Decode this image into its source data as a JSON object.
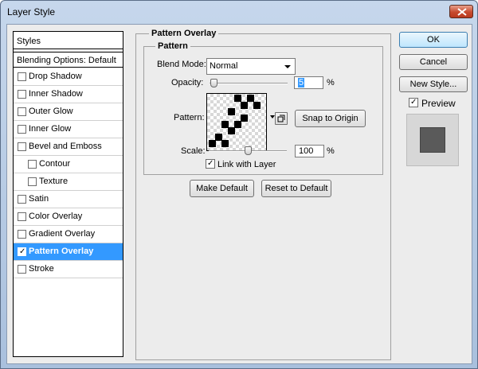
{
  "window": {
    "title": "Layer Style"
  },
  "styles_panel": {
    "header": "Styles",
    "blending_options": "Blending Options: Default",
    "items": [
      {
        "label": "Drop Shadow",
        "checked": false,
        "selected": false,
        "indent": false
      },
      {
        "label": "Inner Shadow",
        "checked": false,
        "selected": false,
        "indent": false
      },
      {
        "label": "Outer Glow",
        "checked": false,
        "selected": false,
        "indent": false
      },
      {
        "label": "Inner Glow",
        "checked": false,
        "selected": false,
        "indent": false
      },
      {
        "label": "Bevel and Emboss",
        "checked": false,
        "selected": false,
        "indent": false
      },
      {
        "label": "Contour",
        "checked": false,
        "selected": false,
        "indent": true
      },
      {
        "label": "Texture",
        "checked": false,
        "selected": false,
        "indent": true
      },
      {
        "label": "Satin",
        "checked": false,
        "selected": false,
        "indent": false
      },
      {
        "label": "Color Overlay",
        "checked": false,
        "selected": false,
        "indent": false
      },
      {
        "label": "Gradient Overlay",
        "checked": false,
        "selected": false,
        "indent": false
      },
      {
        "label": "Pattern Overlay",
        "checked": true,
        "selected": true,
        "indent": false
      },
      {
        "label": "Stroke",
        "checked": false,
        "selected": false,
        "indent": false
      }
    ]
  },
  "pattern_overlay": {
    "group_title": "Pattern Overlay",
    "subgroup_title": "Pattern",
    "blend_mode_label": "Blend Mode:",
    "blend_mode_value": "Normal",
    "opacity_label": "Opacity:",
    "opacity_value": "5",
    "opacity_unit": "%",
    "pattern_label": "Pattern:",
    "snap_to_origin": "Snap to Origin",
    "scale_label": "Scale:",
    "scale_value": "100",
    "scale_unit": "%",
    "link_with_layer_label": "Link with Layer",
    "link_with_layer_checked": true,
    "make_default": "Make Default",
    "reset_to_default": "Reset to Default"
  },
  "actions": {
    "ok": "OK",
    "cancel": "Cancel",
    "new_style": "New Style...",
    "preview_label": "Preview",
    "preview_checked": true
  }
}
